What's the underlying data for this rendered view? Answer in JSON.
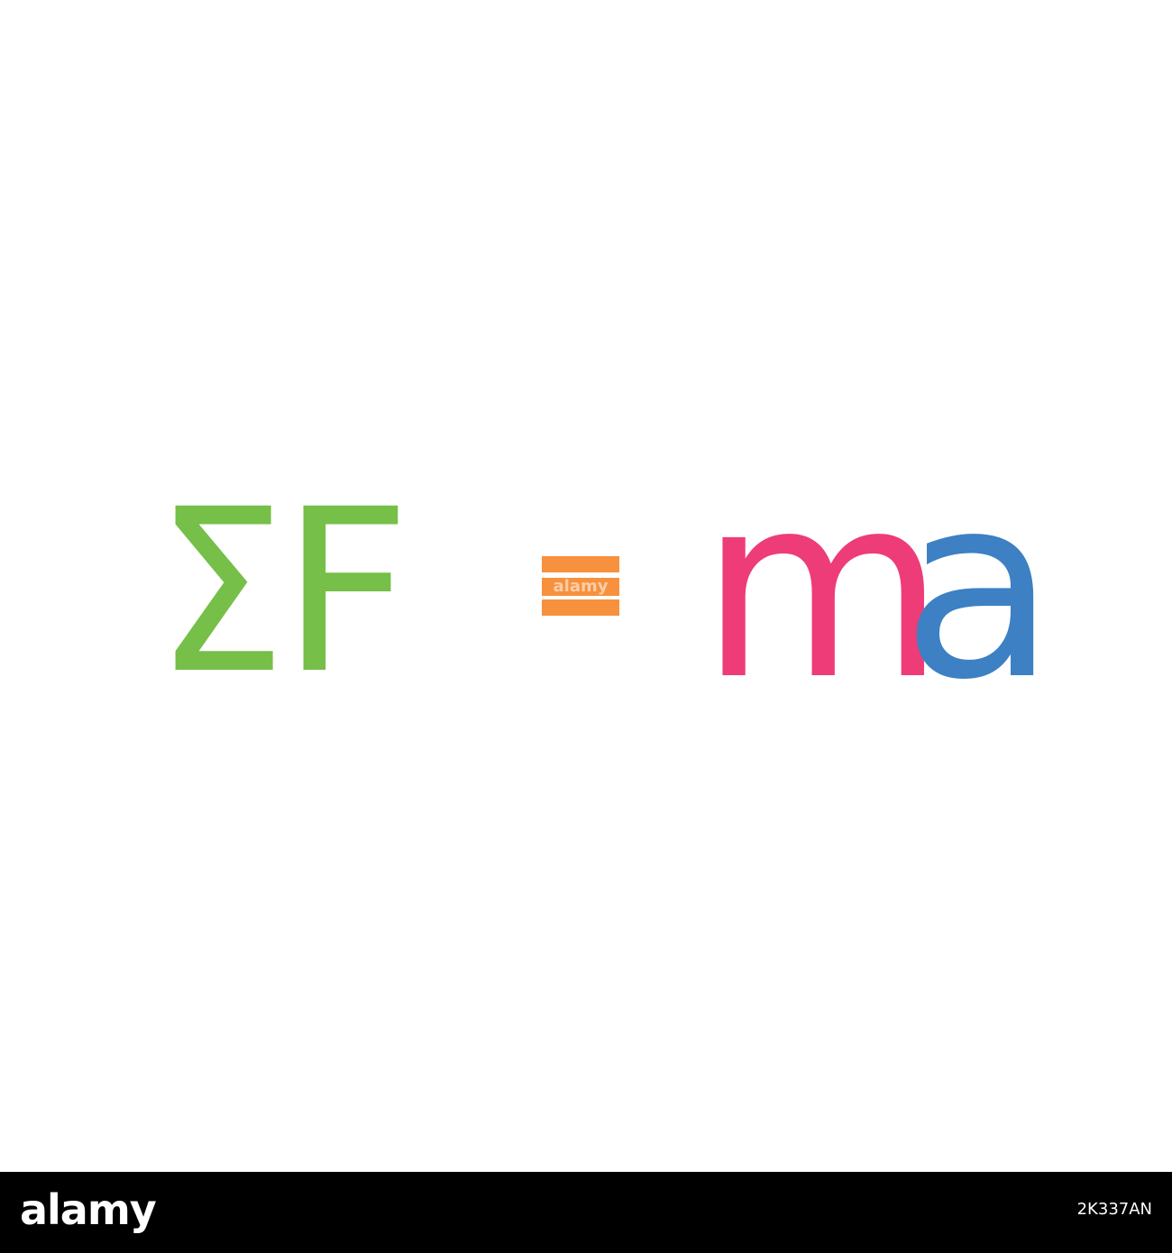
{
  "formula": {
    "sigma": "Σ",
    "force": "F",
    "mass": "m",
    "acceleration": "a",
    "colors": {
      "sigma_force": "#76bf48",
      "equals": "#f7913d",
      "mass": "#ee3c78",
      "acceleration": "#3d80c4"
    }
  },
  "watermark": {
    "text": "alamy"
  },
  "footer": {
    "brand": "alamy",
    "image_id": "2K337AN"
  }
}
